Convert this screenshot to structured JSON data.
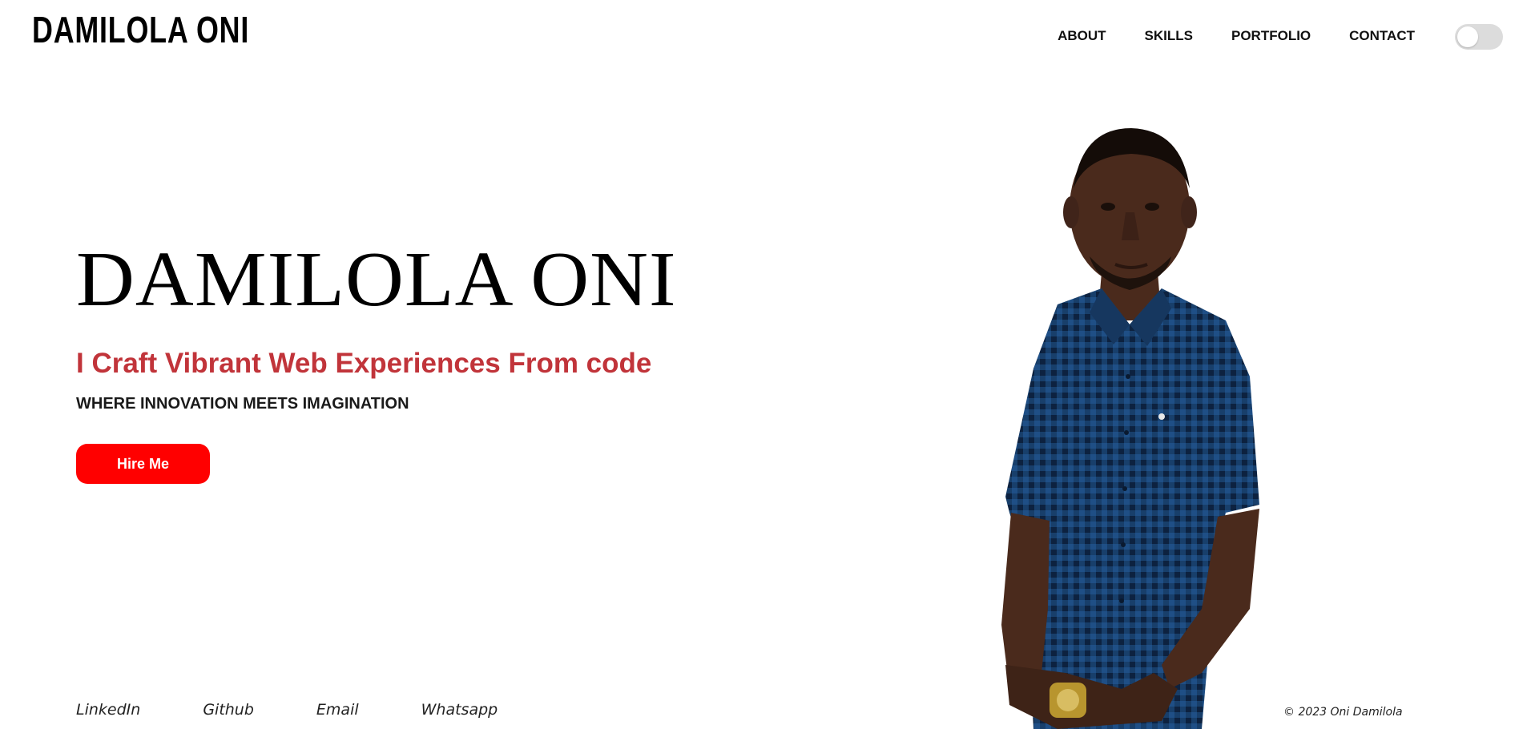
{
  "header": {
    "logo": "DAMILOLA ONI",
    "nav": [
      {
        "label": "ABOUT"
      },
      {
        "label": "SKILLS"
      },
      {
        "label": "PORTFOLIO"
      },
      {
        "label": "CONTACT"
      }
    ],
    "theme_toggle": {
      "icon": "toggle-switch",
      "state": "off"
    }
  },
  "hero": {
    "name": "DAMILOLA ONI",
    "tagline": "I Craft Vibrant Web Experiences From code",
    "subtitle": "WHERE INNOVATION MEETS IMAGINATION",
    "cta_label": "Hire Me"
  },
  "footer": {
    "social_links": [
      {
        "label": "LinkedIn"
      },
      {
        "label": "Github"
      },
      {
        "label": "Email"
      },
      {
        "label": "Whatsapp"
      }
    ],
    "copyright": "© 2023 Oni Damilola"
  },
  "colors": {
    "tagline": "#c1343a",
    "cta_background": "#ff0000",
    "shirt": "#1f4f86",
    "toggle_track": "#dcdcdc"
  }
}
